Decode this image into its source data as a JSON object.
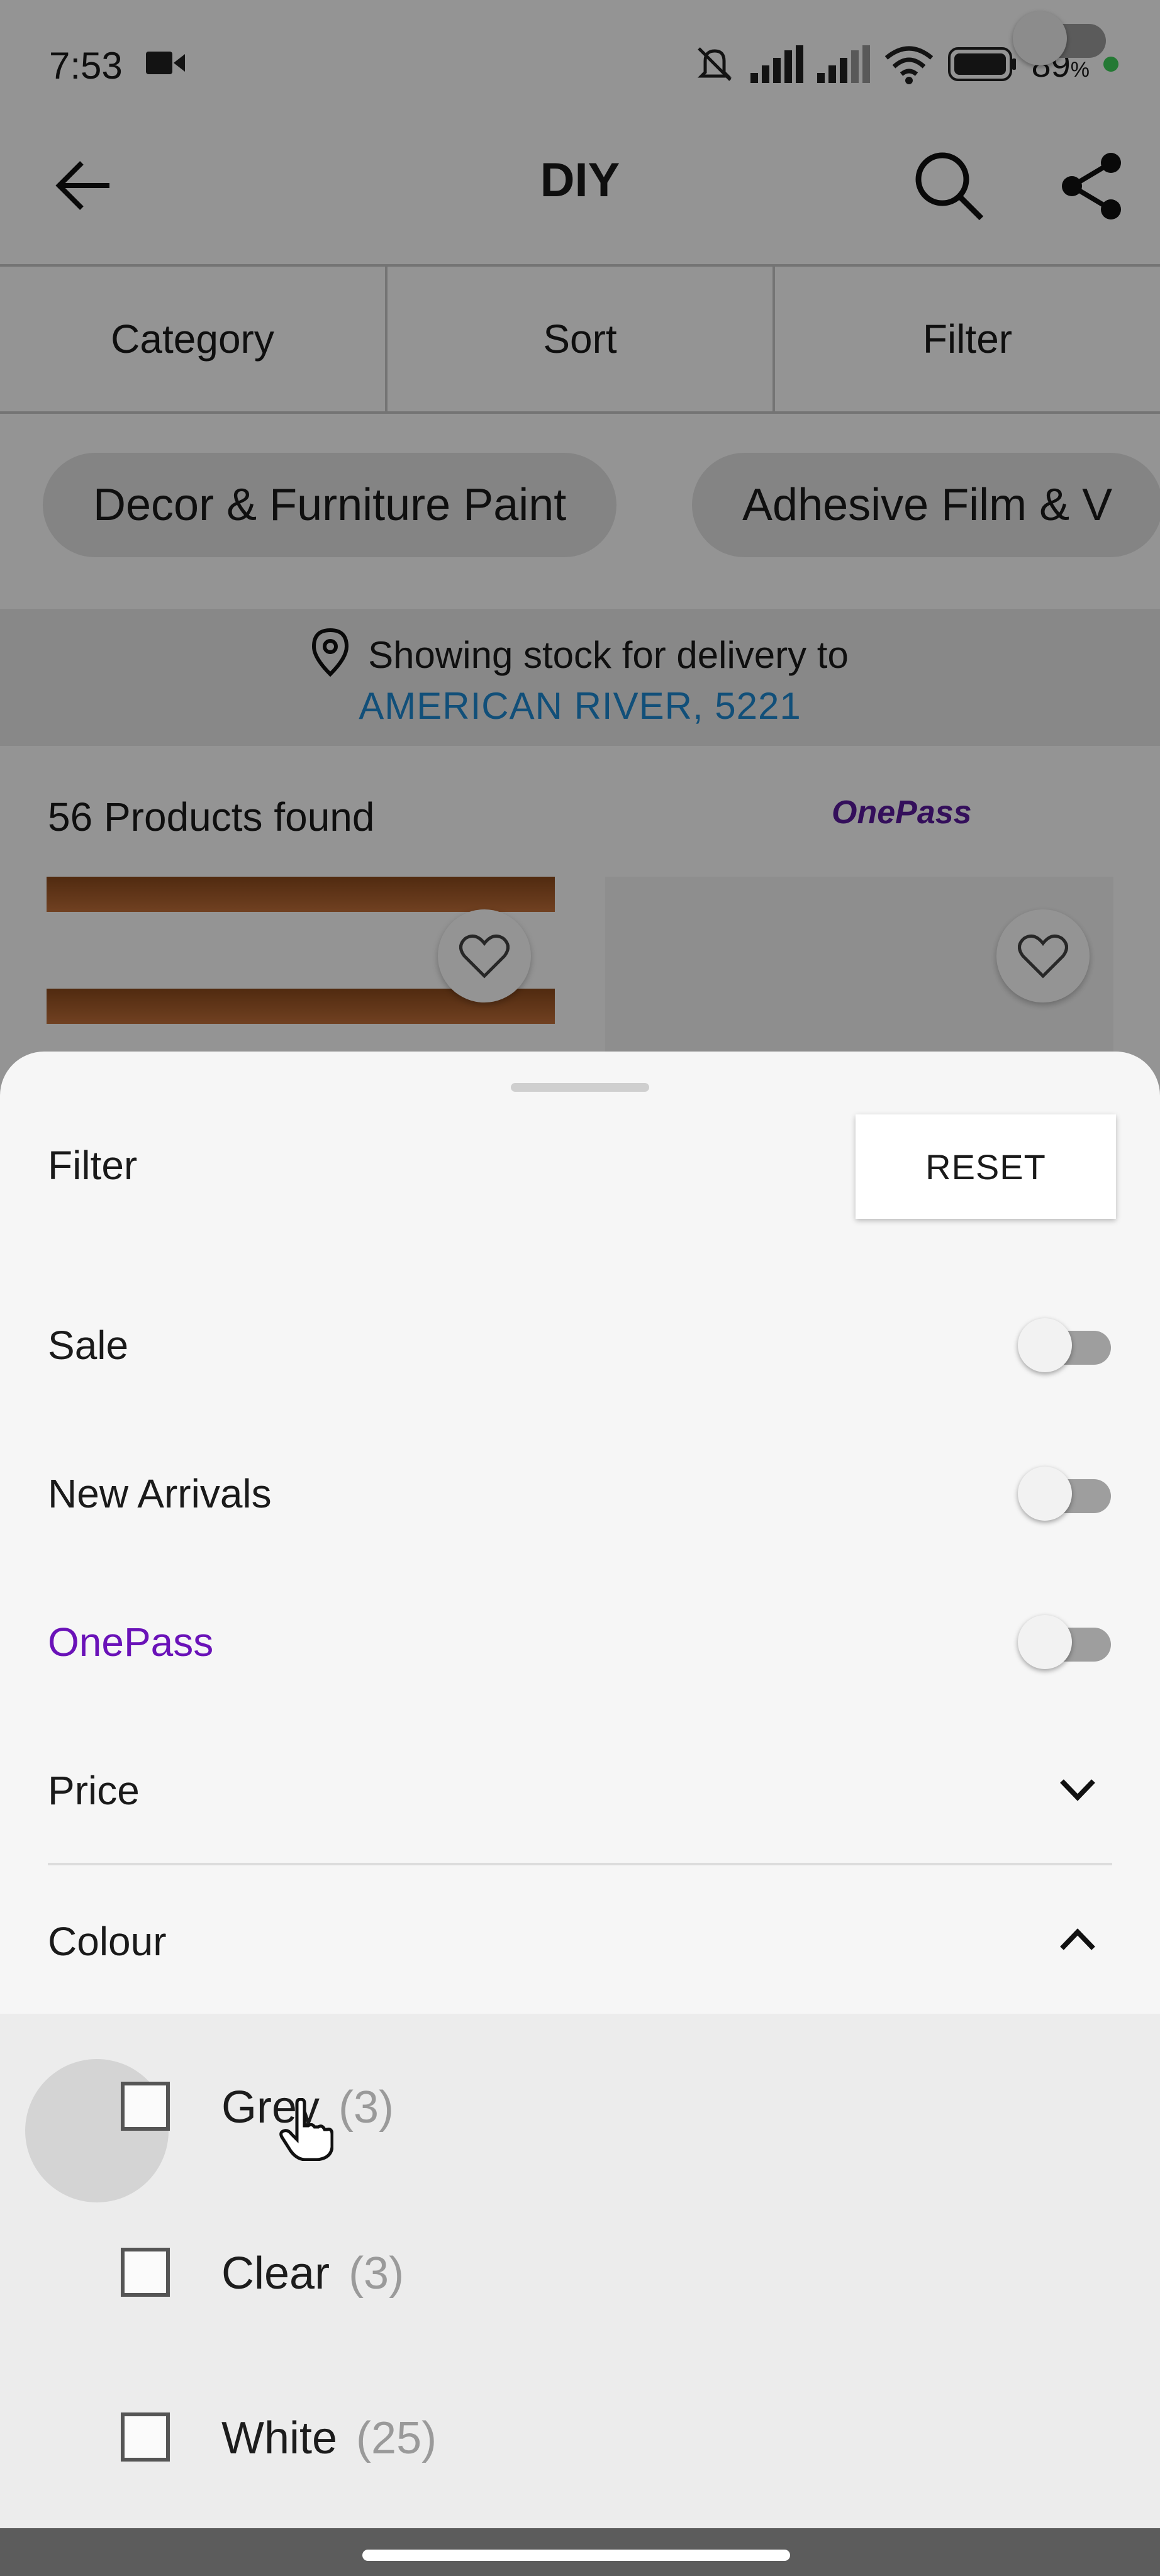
{
  "status": {
    "time": "7:53",
    "battery": "89"
  },
  "header": {
    "title": "DIY"
  },
  "tabs": [
    {
      "label": "Category"
    },
    {
      "label": "Sort"
    },
    {
      "label": "Filter"
    }
  ],
  "chips": [
    {
      "label": "Decor & Furniture Paint"
    },
    {
      "label": "Adhesive Film & V"
    }
  ],
  "delivery": {
    "line1": "Showing stock for delivery to",
    "location": "AMERICAN RIVER, 5221"
  },
  "products": {
    "count_text": "56 Products found",
    "onepass_logo": "OnePass"
  },
  "filter_sheet": {
    "title": "Filter",
    "reset_label": "RESET",
    "toggles": [
      {
        "label": "Sale",
        "on": false
      },
      {
        "label": "New Arrivals",
        "on": false
      },
      {
        "label": "OnePass",
        "on": false
      }
    ],
    "price_label": "Price",
    "colour_label": "Colour",
    "colour_options": [
      {
        "label": "Grey",
        "count": "(3)",
        "checked": false
      },
      {
        "label": "Clear",
        "count": "(3)",
        "checked": false
      },
      {
        "label": "White",
        "count": "(25)",
        "checked": false
      }
    ]
  },
  "colors": {
    "accent_purple": "#6a12b8",
    "link_blue": "#1e88d0"
  }
}
